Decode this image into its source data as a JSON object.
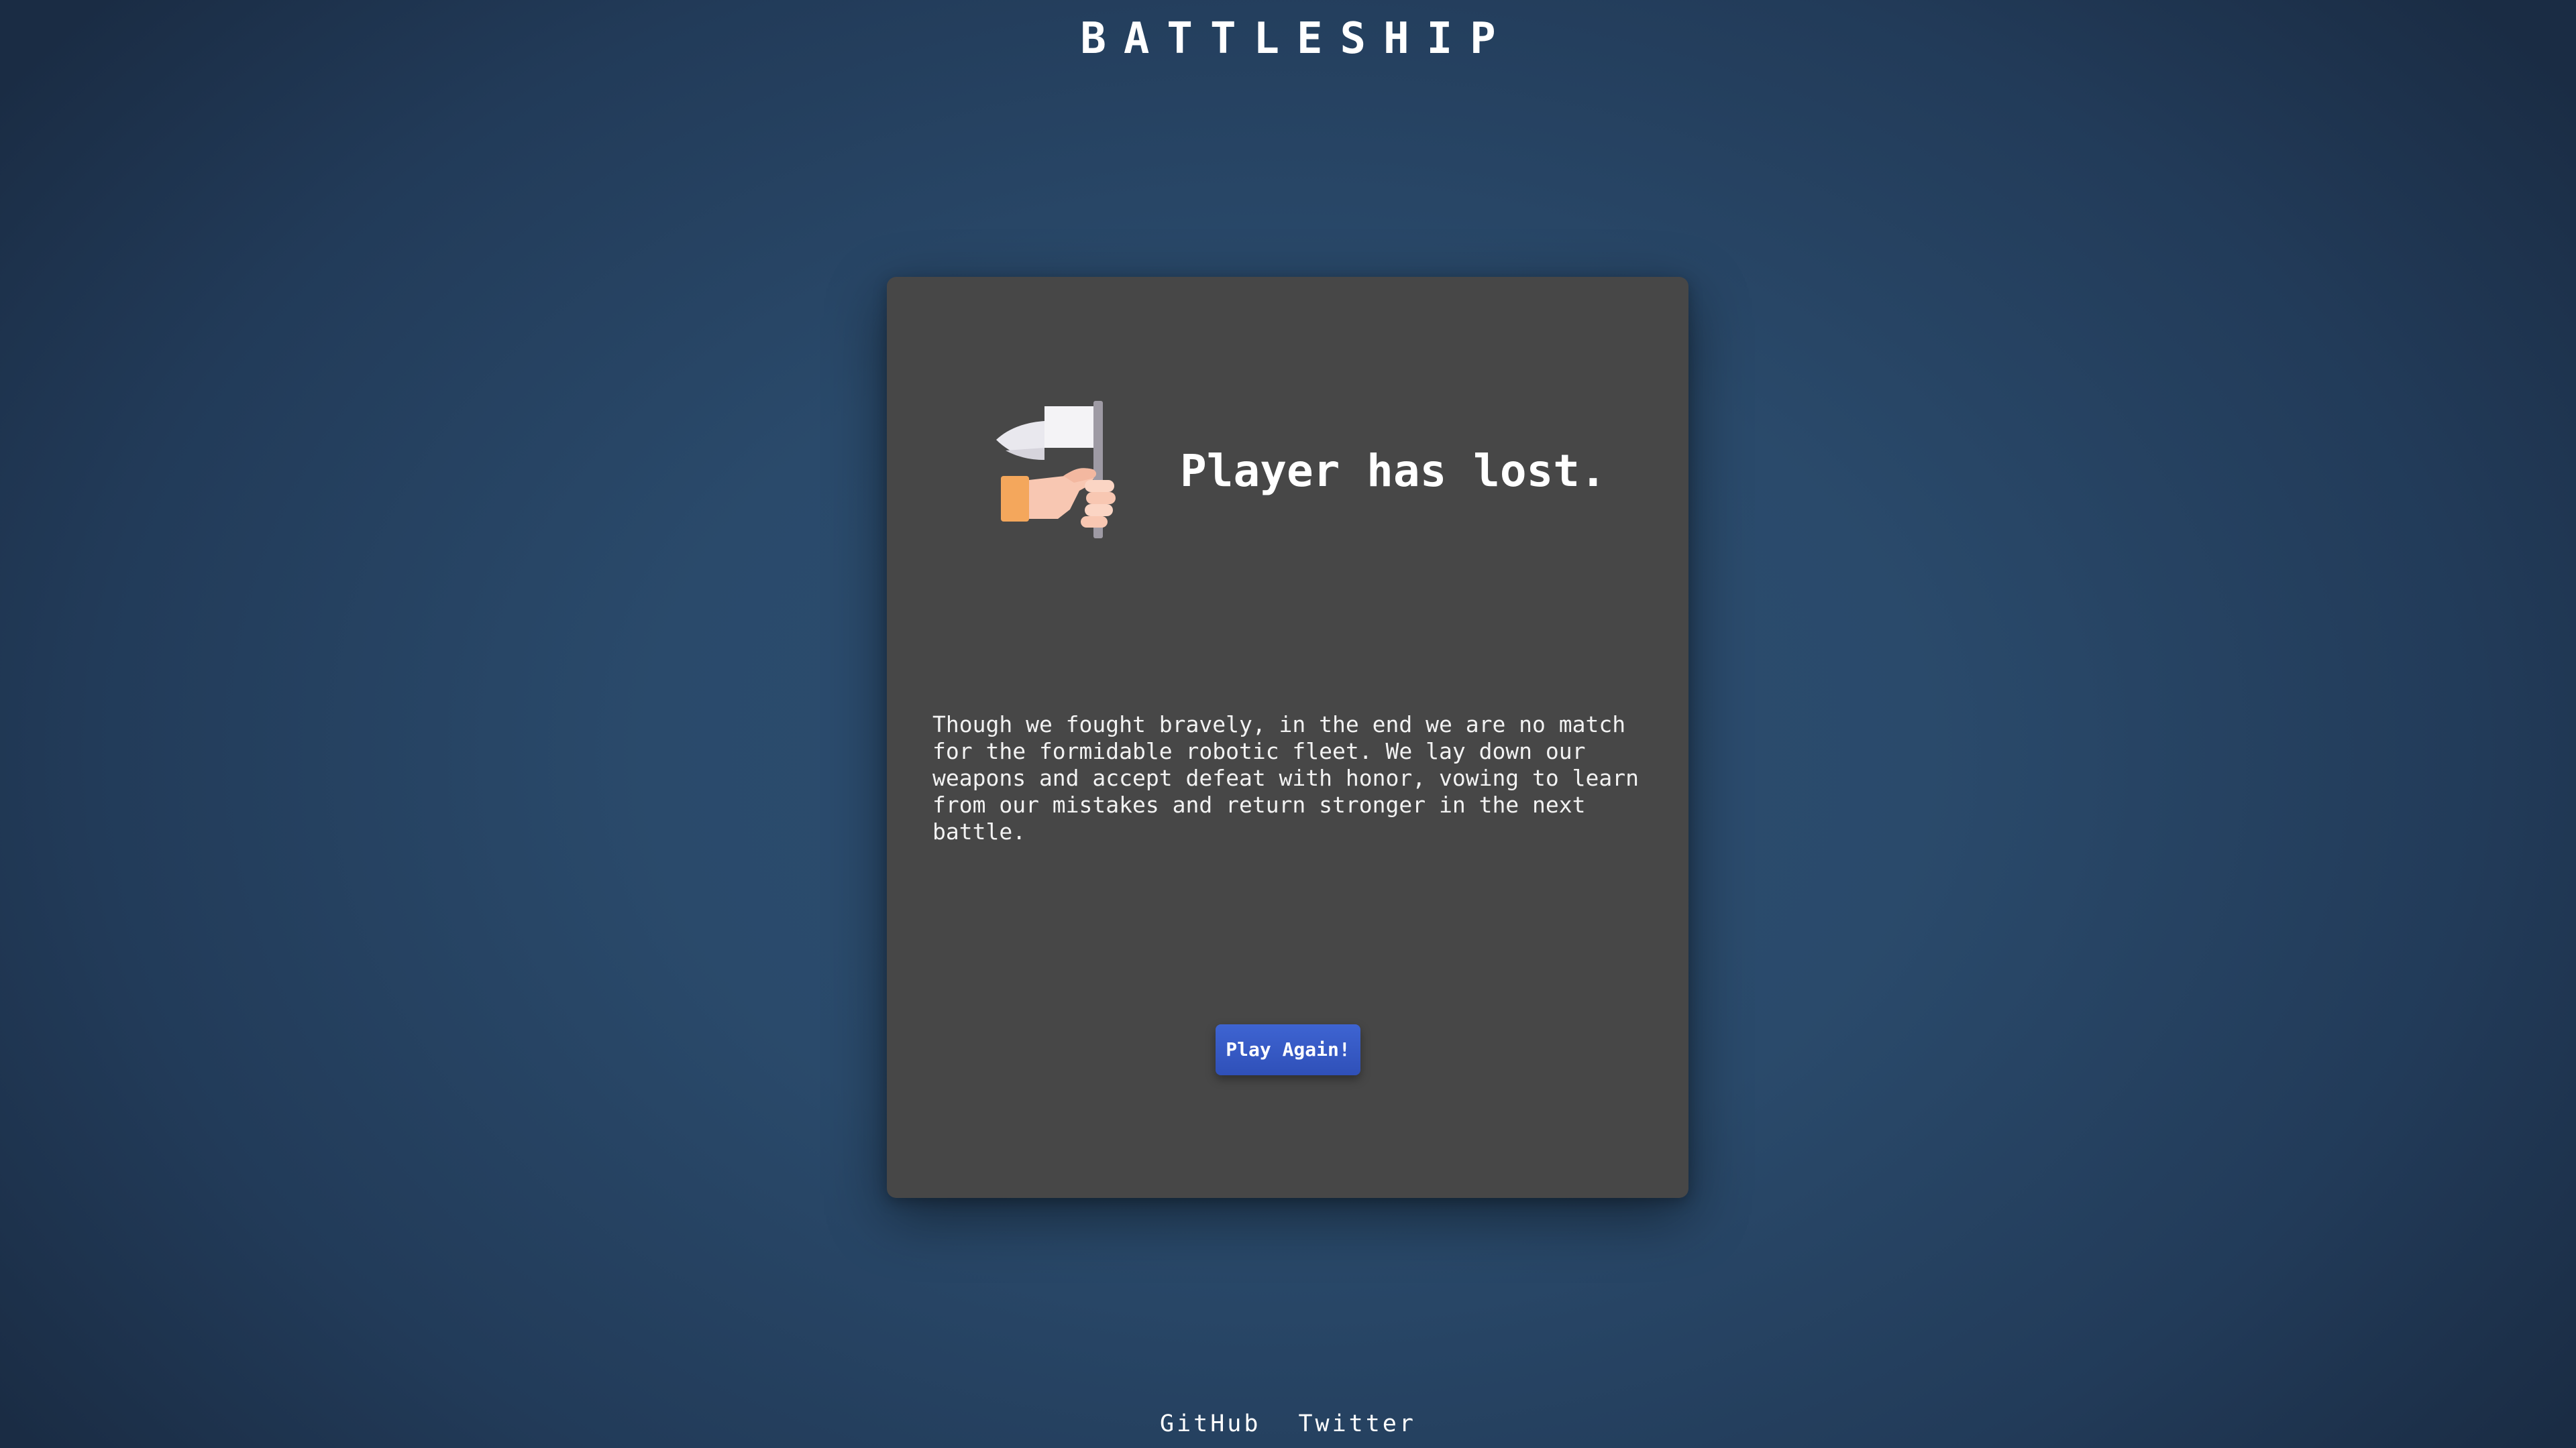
{
  "header": {
    "title": "BATTLESHIP"
  },
  "result": {
    "icon": "white-flag-surrender-icon",
    "heading": "Player has lost.",
    "message": "Though we fought bravely, in the end we are no match for the formidable robotic fleet. We lay down our weapons and accept defeat with honor, vowing to learn from our mistakes and return stronger in the next battle.",
    "button_label": "Play Again!"
  },
  "footer": {
    "links": [
      {
        "label": "GitHub"
      },
      {
        "label": "Twitter"
      }
    ]
  },
  "colors": {
    "background": "#2a4a6b",
    "card": "#474747",
    "button": "#3a5fc8",
    "text": "#ffffff"
  }
}
